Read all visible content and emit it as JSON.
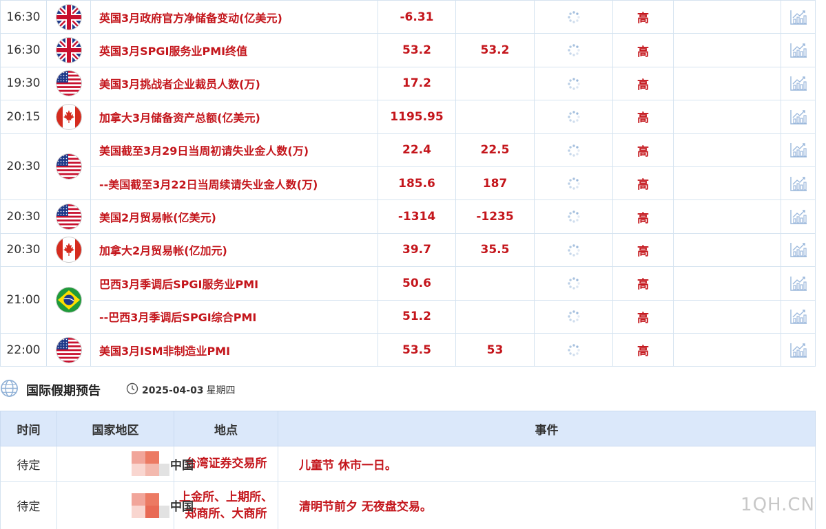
{
  "events": [
    {
      "time": "16:30",
      "flag": "uk-flag-icon",
      "name": "英国3月政府官方净储备变动(亿美元)",
      "actual": "-6.31",
      "forecast": "",
      "importance": "高",
      "time_rowspan": 1
    },
    {
      "time": "16:30",
      "flag": "uk-flag-icon",
      "name": "英国3月SPGI服务业PMI终值",
      "actual": "53.2",
      "forecast": "53.2",
      "importance": "高",
      "time_rowspan": 1
    },
    {
      "time": "19:30",
      "flag": "us-flag-icon",
      "name": "美国3月挑战者企业裁员人数(万)",
      "actual": "17.2",
      "forecast": "",
      "importance": "高",
      "time_rowspan": 1
    },
    {
      "time": "20:15",
      "flag": "canada-flag-icon",
      "name": "加拿大3月储备资产总额(亿美元)",
      "actual": "1195.95",
      "forecast": "",
      "importance": "高",
      "time_rowspan": 1
    },
    {
      "time": "20:30",
      "flag": "us-flag-icon",
      "name": "美国截至3月29日当周初请失业金人数(万)",
      "actual": "22.4",
      "forecast": "22.5",
      "importance": "高",
      "time_rowspan": 2
    },
    {
      "time": "",
      "flag": "",
      "name": "--美国截至3月22日当周续请失业金人数(万)",
      "actual": "185.6",
      "forecast": "187",
      "importance": "高",
      "time_rowspan": 0
    },
    {
      "time": "20:30",
      "flag": "us-flag-icon",
      "name": "美国2月贸易帐(亿美元)",
      "actual": "-1314",
      "forecast": "-1235",
      "importance": "高",
      "time_rowspan": 1
    },
    {
      "time": "20:30",
      "flag": "canada-flag-icon",
      "name": "加拿大2月贸易帐(亿加元)",
      "actual": "39.7",
      "forecast": "35.5",
      "importance": "高",
      "time_rowspan": 1
    },
    {
      "time": "21:00",
      "flag": "brazil-flag-icon",
      "name": "巴西3月季调后SPGI服务业PMI",
      "actual": "50.6",
      "forecast": "",
      "importance": "高",
      "time_rowspan": 2
    },
    {
      "time": "",
      "flag": "",
      "name": "--巴西3月季调后SPGI综合PMI",
      "actual": "51.2",
      "forecast": "",
      "importance": "高",
      "time_rowspan": 0
    },
    {
      "time": "22:00",
      "flag": "us-flag-icon",
      "name": "美国3月ISM非制造业PMI",
      "actual": "53.5",
      "forecast": "53",
      "importance": "高",
      "time_rowspan": 1
    }
  ],
  "holiday": {
    "title": "国际假期预告",
    "date": "2025-04-03",
    "weekday": "星期四",
    "headers": {
      "time": "时间",
      "region": "国家地区",
      "place": "地点",
      "event": "事件"
    },
    "rows": [
      {
        "time": "待定",
        "country": "中国",
        "place_line1": "台湾证券交易所",
        "place_line2": "",
        "event": "儿童节 休市一日。"
      },
      {
        "time": "待定",
        "country": "中国",
        "place_line1": "上金所、上期所、",
        "place_line2": "郑商所、大商所",
        "event": "清明节前夕 无夜盘交易。"
      }
    ]
  },
  "watermark": "1QH.CN",
  "colors": {
    "accent_red": "#c4161c",
    "header_blue": "#dbe8fa",
    "border": "#d5e3f0"
  }
}
